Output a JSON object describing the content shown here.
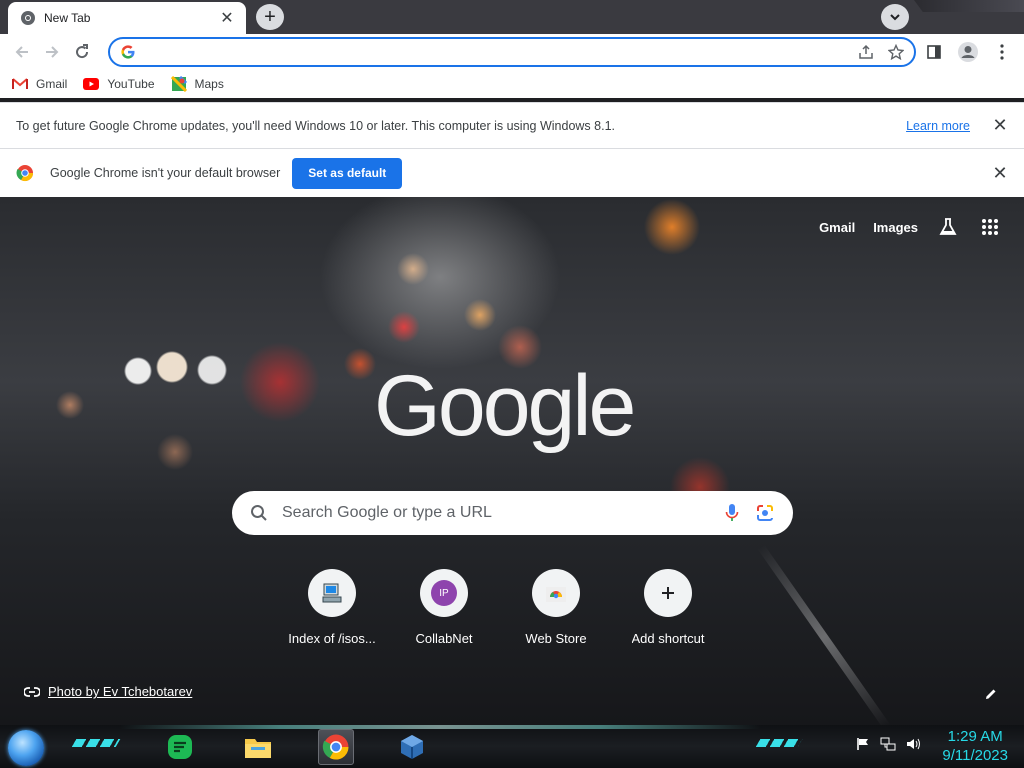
{
  "browser": {
    "tab": {
      "title": "New Tab"
    },
    "omnibox": {
      "value": "",
      "placeholder": ""
    },
    "bookmarks": [
      {
        "label": "Gmail",
        "icon": "gmail-icon"
      },
      {
        "label": "YouTube",
        "icon": "youtube-icon"
      },
      {
        "label": "Maps",
        "icon": "maps-icon"
      }
    ],
    "infobar_update": {
      "message": "To get future Google Chrome updates, you'll need Windows 10 or later. This computer is using Windows 8.1.",
      "link": "Learn more"
    },
    "infobar_default": {
      "message": "Google Chrome isn't your default browser",
      "button": "Set as default"
    }
  },
  "ntp": {
    "top_links": {
      "gmail": "Gmail",
      "images": "Images"
    },
    "logo_text": "Google",
    "search_placeholder": "Search Google or type a URL",
    "shortcuts": [
      {
        "label": "Index of /isos...",
        "icon": "computer-icon"
      },
      {
        "label": "CollabNet",
        "icon": "ip-avatar-icon",
        "initials": "IP"
      },
      {
        "label": "Web Store",
        "icon": "webstore-icon"
      },
      {
        "label": "Add shortcut",
        "icon": "plus-icon"
      }
    ],
    "photo_credit": "Photo by Ev Tchebotarev"
  },
  "taskbar": {
    "apps": [
      "start-orb",
      "notes-app-icon",
      "file-explorer-icon",
      "chrome-icon",
      "virtualbox-icon"
    ],
    "clock": {
      "time": "1:29 AM",
      "date": "9/11/2023"
    }
  },
  "colors": {
    "accent": "#1a73e8",
    "clock": "#27d9e6",
    "tabstrip": "#3a3a40"
  }
}
